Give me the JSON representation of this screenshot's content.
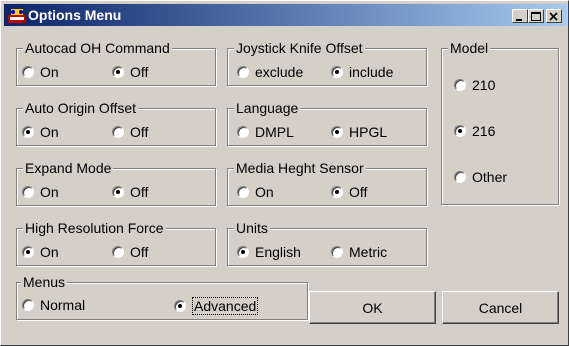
{
  "window": {
    "title": "Options Menu"
  },
  "groups": {
    "autocad": {
      "legend": "Autocad OH Command",
      "options": [
        {
          "label": "On",
          "checked": false
        },
        {
          "label": "Off",
          "checked": true
        }
      ]
    },
    "joystick": {
      "legend": "Joystick Knife Offset",
      "options": [
        {
          "label": "exclude",
          "checked": false
        },
        {
          "label": "include",
          "checked": true
        }
      ]
    },
    "model": {
      "legend": "Model",
      "options": [
        {
          "label": "210",
          "checked": false
        },
        {
          "label": "216",
          "checked": true
        },
        {
          "label": "Other",
          "checked": false
        }
      ]
    },
    "auto_origin": {
      "legend": "Auto Origin Offset",
      "options": [
        {
          "label": "On",
          "checked": true
        },
        {
          "label": "Off",
          "checked": false
        }
      ]
    },
    "language": {
      "legend": "Language",
      "options": [
        {
          "label": "DMPL",
          "checked": false
        },
        {
          "label": "HPGL",
          "checked": true
        }
      ]
    },
    "expand": {
      "legend": "Expand Mode",
      "options": [
        {
          "label": "On",
          "checked": false
        },
        {
          "label": "Off",
          "checked": true
        }
      ]
    },
    "media": {
      "legend": "Media Heght Sensor",
      "options": [
        {
          "label": "On",
          "checked": false
        },
        {
          "label": "Off",
          "checked": true
        }
      ]
    },
    "high_res": {
      "legend": "High Resolution Force",
      "options": [
        {
          "label": "On",
          "checked": true
        },
        {
          "label": "Off",
          "checked": false
        }
      ]
    },
    "units": {
      "legend": "Units",
      "options": [
        {
          "label": "English",
          "checked": true
        },
        {
          "label": "Metric",
          "checked": false
        }
      ]
    },
    "menus": {
      "legend": "Menus",
      "options": [
        {
          "label": "Normal",
          "checked": false
        },
        {
          "label": "Advanced",
          "checked": true
        }
      ]
    }
  },
  "buttons": {
    "ok": "OK",
    "cancel": "Cancel"
  }
}
